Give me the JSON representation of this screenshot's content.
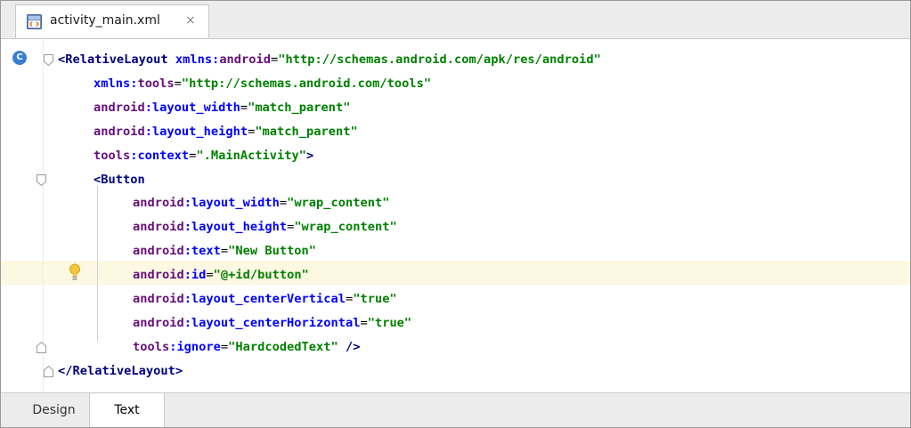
{
  "file_tab": {
    "name": "activity_main.xml",
    "close": "×",
    "icon": "xml-layout-file-icon"
  },
  "editor": {
    "gutter_badge": "C",
    "lines": [
      [
        {
          "t": "<",
          "c": "tag"
        },
        {
          "t": "RelativeLayout ",
          "c": "tag"
        },
        {
          "t": "xmlns:",
          "c": "attr"
        },
        {
          "t": "android",
          "c": "ns"
        },
        {
          "t": "=",
          "c": "punc"
        },
        {
          "t": "\"http://schemas.android.com/apk/res/android\"",
          "c": "val"
        }
      ],
      [
        {
          "t": "xmlns:",
          "c": "attr"
        },
        {
          "t": "tools",
          "c": "ns"
        },
        {
          "t": "=",
          "c": "punc"
        },
        {
          "t": "\"http://schemas.android.com/tools\"",
          "c": "val"
        }
      ],
      [
        {
          "t": "android",
          "c": "ns"
        },
        {
          "t": ":layout_width",
          "c": "attr"
        },
        {
          "t": "=",
          "c": "punc"
        },
        {
          "t": "\"match_parent\"",
          "c": "val"
        }
      ],
      [
        {
          "t": "android",
          "c": "ns"
        },
        {
          "t": ":layout_height",
          "c": "attr"
        },
        {
          "t": "=",
          "c": "punc"
        },
        {
          "t": "\"match_parent\"",
          "c": "val"
        }
      ],
      [
        {
          "t": "tools",
          "c": "ns"
        },
        {
          "t": ":context",
          "c": "attr"
        },
        {
          "t": "=",
          "c": "punc"
        },
        {
          "t": "\".MainActivity\"",
          "c": "val"
        },
        {
          "t": ">",
          "c": "tag"
        }
      ],
      [
        {
          "t": "<",
          "c": "tag"
        },
        {
          "t": "Button",
          "c": "tag"
        }
      ],
      [
        {
          "t": "android",
          "c": "ns"
        },
        {
          "t": ":layout_width",
          "c": "attr"
        },
        {
          "t": "=",
          "c": "punc"
        },
        {
          "t": "\"wrap_content\"",
          "c": "val"
        }
      ],
      [
        {
          "t": "android",
          "c": "ns"
        },
        {
          "t": ":layout_height",
          "c": "attr"
        },
        {
          "t": "=",
          "c": "punc"
        },
        {
          "t": "\"wrap_content\"",
          "c": "val"
        }
      ],
      [
        {
          "t": "android",
          "c": "ns"
        },
        {
          "t": ":text",
          "c": "attr"
        },
        {
          "t": "=",
          "c": "punc"
        },
        {
          "t": "\"New Button\"",
          "c": "val"
        }
      ],
      [
        {
          "t": "android",
          "c": "ns"
        },
        {
          "t": ":id",
          "c": "attr"
        },
        {
          "t": "=",
          "c": "punc"
        },
        {
          "t": "\"@+id/button\"",
          "c": "val"
        }
      ],
      [
        {
          "t": "android",
          "c": "ns"
        },
        {
          "t": ":layout_centerVertical",
          "c": "attr"
        },
        {
          "t": "=",
          "c": "punc"
        },
        {
          "t": "\"true\"",
          "c": "val"
        }
      ],
      [
        {
          "t": "android",
          "c": "ns"
        },
        {
          "t": ":layout_centerHorizontal",
          "c": "attr"
        },
        {
          "t": "=",
          "c": "punc"
        },
        {
          "t": "\"true\"",
          "c": "val"
        }
      ],
      [
        {
          "t": "tools",
          "c": "ns"
        },
        {
          "t": ":ignore",
          "c": "attr"
        },
        {
          "t": "=",
          "c": "punc"
        },
        {
          "t": "\"HardcodedText\"",
          "c": "val"
        },
        {
          "t": " />",
          "c": "tag"
        }
      ],
      [
        {
          "t": "</",
          "c": "tag"
        },
        {
          "t": "RelativeLayout",
          "c": "tag"
        },
        {
          "t": ">",
          "c": "tag"
        }
      ]
    ],
    "indent_levels": [
      0,
      1,
      1,
      1,
      1,
      1,
      2,
      2,
      2,
      2,
      2,
      2,
      2,
      0
    ],
    "fold_open_lines": [
      0,
      5
    ],
    "fold_close_lines": [
      12,
      13
    ],
    "current_line": 9,
    "intention_icon": "lightbulb-icon"
  },
  "bottom_tabs": [
    {
      "label": "Design",
      "active": false
    },
    {
      "label": "Text",
      "active": true
    }
  ],
  "colors": {
    "tag": "#000080",
    "attribute": "#0000ff",
    "namespace": "#660e7a",
    "value": "#008000",
    "current_line": "#fdf8e2"
  }
}
